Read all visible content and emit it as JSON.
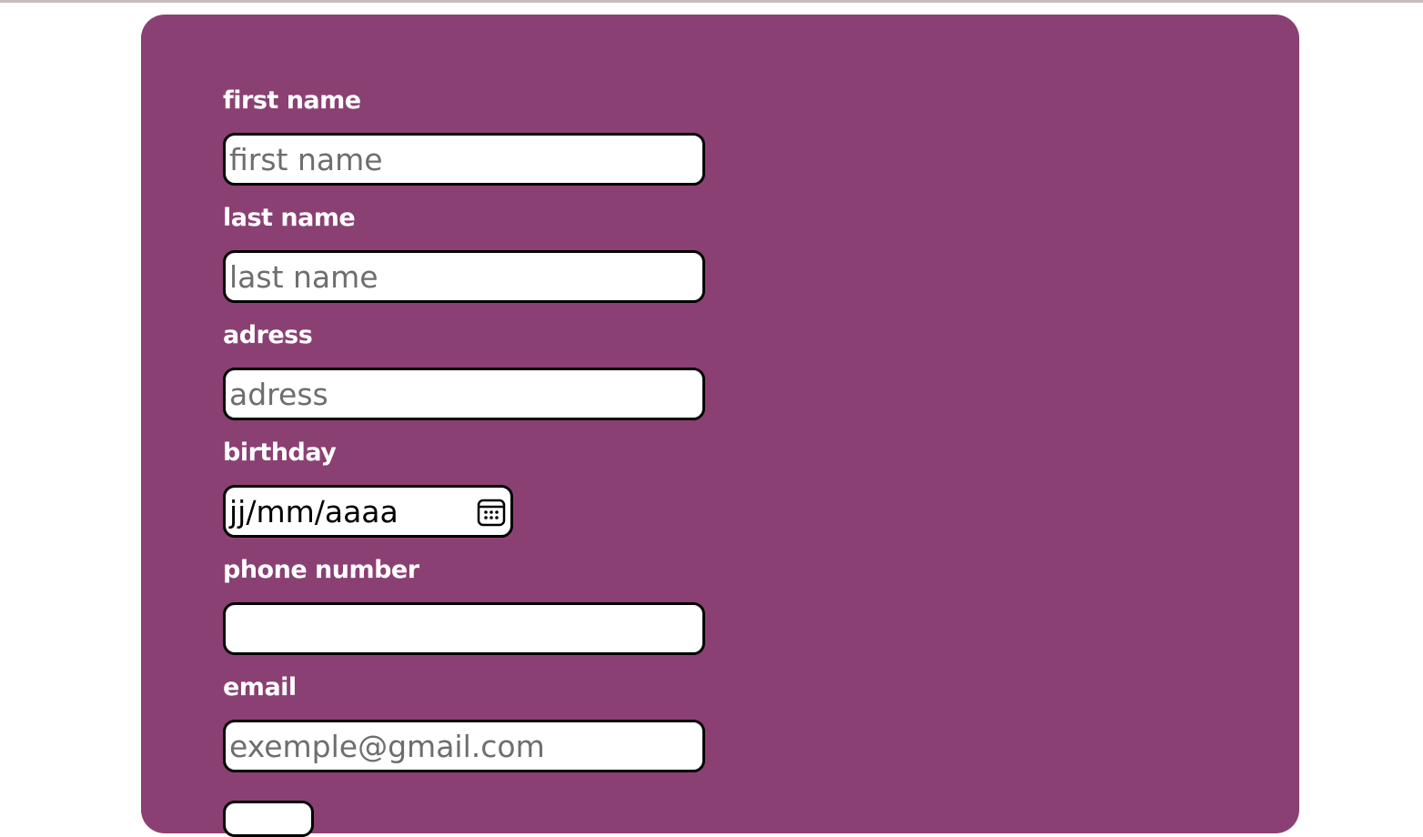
{
  "form": {
    "first_name": {
      "label": "first name",
      "placeholder": "first name"
    },
    "last_name": {
      "label": "last name",
      "placeholder": "last name"
    },
    "address": {
      "label": "adress",
      "placeholder": "adress"
    },
    "birthday": {
      "label": "birthday",
      "value": "jj/mm/aaaa",
      "icon": "calendar-icon"
    },
    "phone": {
      "label": "phone number",
      "placeholder": ""
    },
    "email": {
      "label": "email",
      "placeholder": "exemple@gmail.com"
    }
  },
  "colors": {
    "card_background": "#8b4073",
    "label_text": "#ffffff",
    "input_border": "#000000",
    "placeholder_text": "#6e6e6e"
  }
}
